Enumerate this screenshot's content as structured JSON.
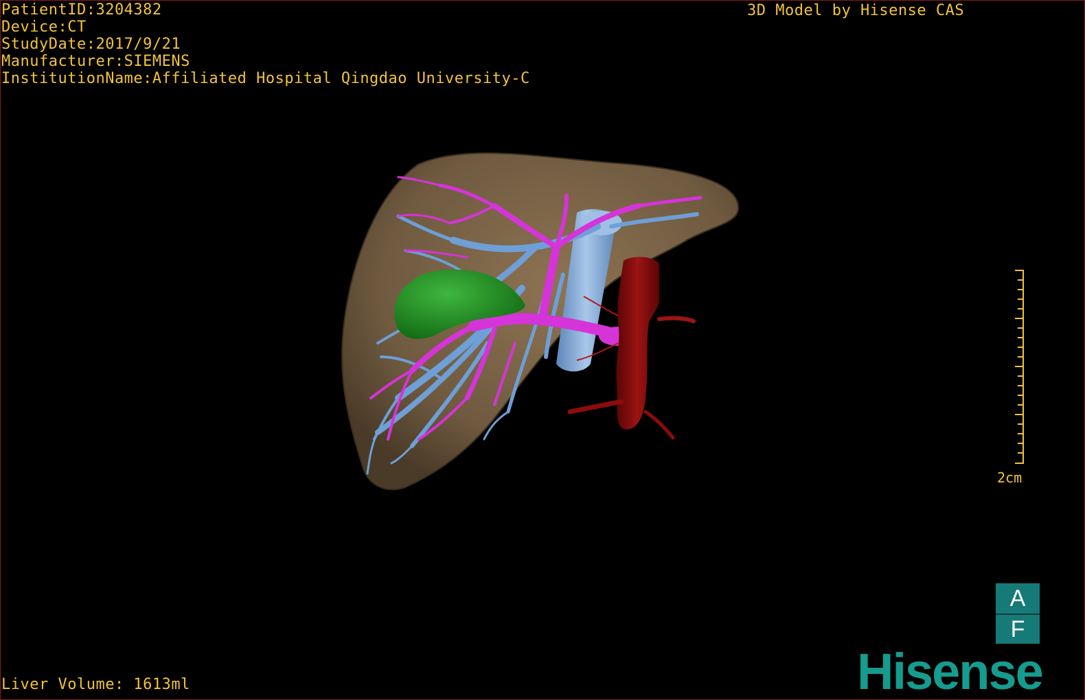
{
  "header": {
    "patient_id": "PatientID:3204382",
    "device": "Device:CT",
    "study_date": "StudyDate:2017/9/21",
    "manufacturer": "Manufacturer:SIEMENS",
    "institution": "InstitutionName:Affiliated Hospital Qingdao University-C"
  },
  "brand_top": "3D Model by Hisense CAS",
  "footer": {
    "liver_volume": "Liver Volume: 1613ml"
  },
  "scale_bar": {
    "label": "2cm"
  },
  "orientation": {
    "top": "A",
    "bottom": "F"
  },
  "logo": {
    "text": "Hisense"
  },
  "model": {
    "structures": [
      "liver",
      "gallbladder",
      "portal-vein",
      "hepatic-vein",
      "inferior-vena-cava",
      "aorta"
    ],
    "colors": {
      "liver": "#7a6245",
      "gallbladder": "#1f8a1f",
      "portal_vein": "#d534d8",
      "hepatic_vein": "#6e9fd6",
      "ivc": "#8fb6e0",
      "aorta": "#8e0b0b"
    }
  },
  "colors": {
    "overlay_text": "#f2c33a",
    "brand": "#169b8f",
    "frame": "#8a1a1a"
  }
}
